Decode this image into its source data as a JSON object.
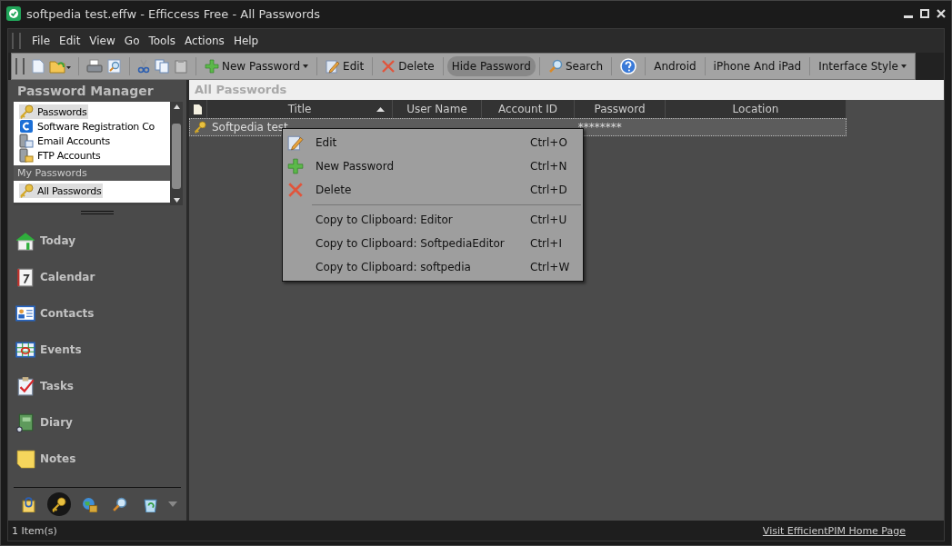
{
  "window": {
    "title": "softpedia test.effw - Efficcess Free - All Passwords"
  },
  "menu_bar": [
    "File",
    "Edit",
    "View",
    "Go",
    "Tools",
    "Actions",
    "Help"
  ],
  "toolbar": [
    {
      "kind": "button",
      "label": "New Password",
      "dropdown": true,
      "pressed": false
    },
    {
      "kind": "button",
      "label": "Edit",
      "dropdown": false,
      "pressed": false
    },
    {
      "kind": "button",
      "label": "Delete",
      "dropdown": false,
      "pressed": false
    },
    {
      "kind": "button",
      "label": "Hide Password",
      "dropdown": false,
      "pressed": true
    },
    {
      "kind": "button",
      "label": "Search",
      "dropdown": false,
      "pressed": false
    },
    {
      "kind": "help"
    },
    {
      "kind": "button",
      "label": "Android",
      "dropdown": false,
      "pressed": false
    },
    {
      "kind": "button",
      "label": "iPhone And iPad",
      "dropdown": false,
      "pressed": false
    },
    {
      "kind": "button",
      "label": "Interface Style",
      "dropdown": true,
      "pressed": false
    }
  ],
  "sidebar": {
    "title": "Password Manager",
    "categories": [
      {
        "label": "Passwords",
        "selected": true
      },
      {
        "label": "Software Registration Co",
        "selected": false
      },
      {
        "label": "Email Accounts",
        "selected": false
      },
      {
        "label": "FTP Accounts",
        "selected": false
      }
    ],
    "group_title": "My Passwords",
    "my_passwords": [
      {
        "label": "All Passwords",
        "selected": true
      }
    ],
    "nav": [
      {
        "label": "Today"
      },
      {
        "label": "Calendar"
      },
      {
        "label": "Contacts"
      },
      {
        "label": "Events"
      },
      {
        "label": "Tasks"
      },
      {
        "label": "Diary"
      },
      {
        "label": "Notes"
      }
    ],
    "shortcuts": [
      {
        "selected": false
      },
      {
        "selected": true
      },
      {
        "selected": false
      },
      {
        "selected": false
      },
      {
        "selected": false
      }
    ]
  },
  "view_title": "All Passwords",
  "table": {
    "columns": [
      {
        "label": "Title",
        "sorted": true
      },
      {
        "label": "User Name",
        "sorted": false
      },
      {
        "label": "Account ID",
        "sorted": false
      },
      {
        "label": "Password",
        "sorted": false
      },
      {
        "label": "Location",
        "sorted": false
      }
    ],
    "rows": [
      {
        "title": "Softpedia test",
        "password": "********",
        "selected": true
      }
    ]
  },
  "context_menu": [
    {
      "kind": "item",
      "label": "Edit",
      "shortcut": "Ctrl+O"
    },
    {
      "kind": "item",
      "label": "New Password",
      "shortcut": "Ctrl+N"
    },
    {
      "kind": "item",
      "label": "Delete",
      "shortcut": "Ctrl+D"
    },
    {
      "kind": "separator"
    },
    {
      "kind": "item",
      "label": "Copy to Clipboard: Editor",
      "shortcut": "Ctrl+U"
    },
    {
      "kind": "item",
      "label": "Copy to Clipboard: SoftpediaEditor",
      "shortcut": "Ctrl+I"
    },
    {
      "kind": "item",
      "label": "Copy to Clipboard: softpedia",
      "shortcut": "Ctrl+W"
    }
  ],
  "status_bar": {
    "count": "1 Item(s)",
    "link": "Visit EfficientPIM Home Page"
  }
}
